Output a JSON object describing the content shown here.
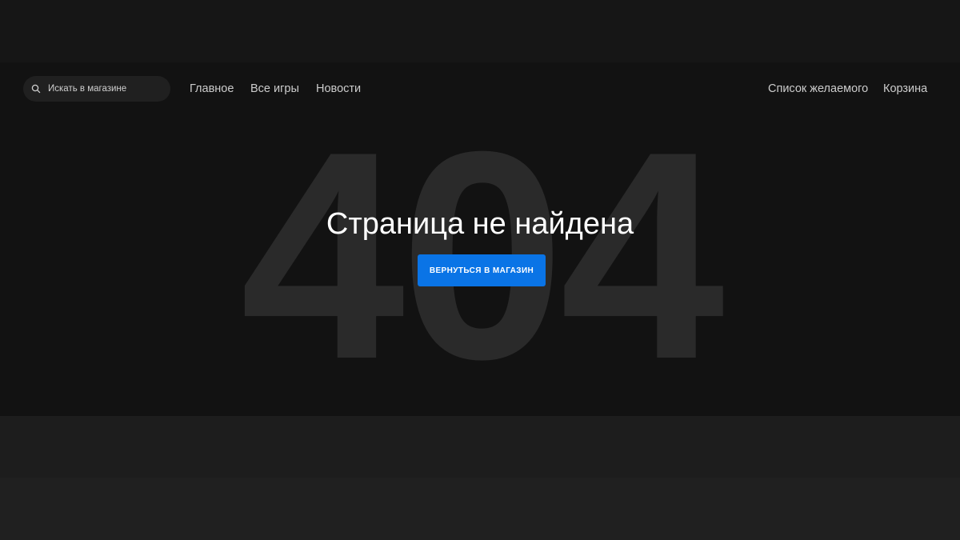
{
  "header": {
    "search": {
      "placeholder": "Искать в магазине",
      "value": "",
      "icon": "search-icon"
    },
    "nav_links": [
      "Главное",
      "Все игры",
      "Новости"
    ],
    "right_links": [
      "Список желаемого",
      "Корзина"
    ]
  },
  "error_page": {
    "code": "404",
    "title": "Страница не найдена",
    "button_label": "ВЕРНУТЬСЯ В МАГАЗИН"
  },
  "colors": {
    "background": "#121212",
    "accent_button": "#0a74e6",
    "code_watermark": "#2a2a2a"
  }
}
